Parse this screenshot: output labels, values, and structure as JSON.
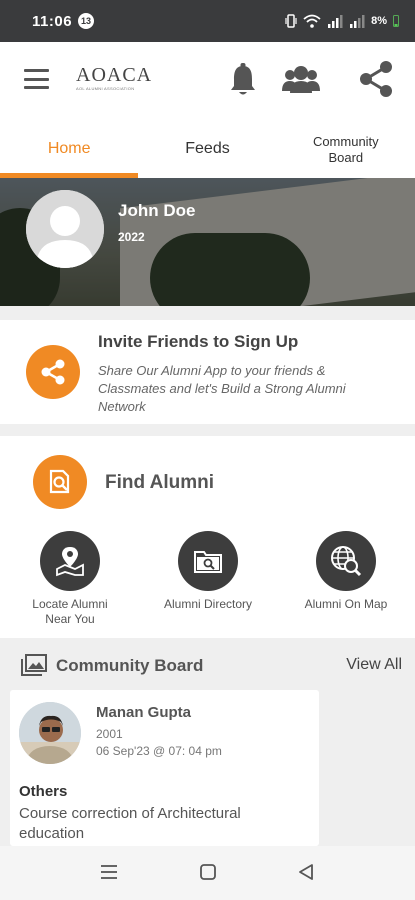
{
  "status_bar": {
    "time": "11:06",
    "notification_count": "13",
    "battery": "8%"
  },
  "app_bar": {
    "logo_text": "AOACA",
    "logo_subtext": "AOL ALUMNI ASSOCIATION"
  },
  "tabs": [
    {
      "label": "Home",
      "active": true
    },
    {
      "label": "Feeds",
      "active": false
    },
    {
      "label": "Community Board",
      "active": false
    }
  ],
  "profile": {
    "name": "John Doe",
    "year": "2022"
  },
  "invite": {
    "title": "Invite Friends to Sign Up",
    "description": "Share Our Alumni App to your friends & Classmates and let's Build a Strong Alumni Network"
  },
  "find_alumni": {
    "title": "Find Alumni",
    "options": [
      {
        "label": "Locate Alumni Near You",
        "icon": "map-pin-icon"
      },
      {
        "label": "Alumni Directory",
        "icon": "directory-search-icon"
      },
      {
        "label": "Alumni On Map",
        "icon": "globe-search-icon"
      }
    ]
  },
  "community_board": {
    "title": "Community Board",
    "view_all": "View All",
    "post": {
      "author": "Manan Gupta",
      "year": "2001",
      "date": "06 Sep'23 @ 07: 04 pm",
      "category": "Others",
      "text": "Course correction of Architectural education"
    }
  },
  "colors": {
    "accent": "#f08a24",
    "status_bar": "#3a3b3d",
    "icon_dark": "#3d3d3d"
  }
}
